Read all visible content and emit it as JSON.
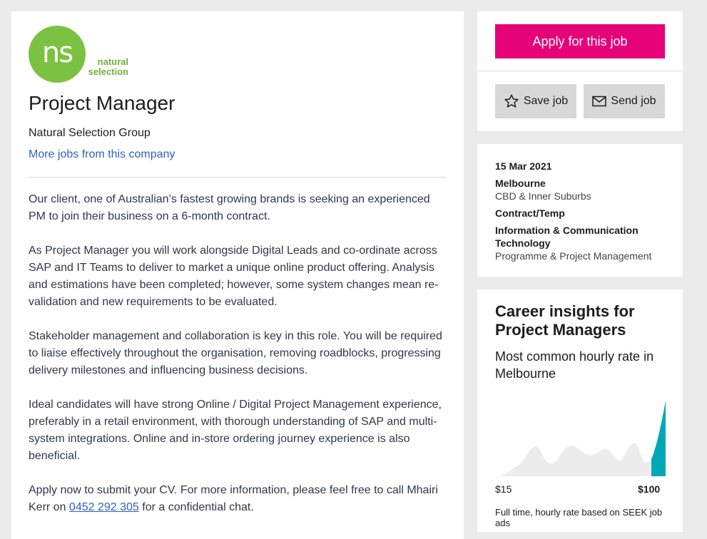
{
  "logo": {
    "initials": "ns",
    "text_line1": "natural",
    "text_line2": "selection"
  },
  "job": {
    "title": "Project Manager",
    "company": "Natural Selection Group",
    "more_jobs_link": "More jobs from this company"
  },
  "description": {
    "p1": "Our client, one of Australian’s fastest growing brands is seeking an experienced PM to join their business on a 6-month contract.",
    "p2": "As Project Manager you will work alongside Digital Leads and co-ordinate across SAP and IT Teams to deliver to market a unique online product offering.  Analysis and estimations have been completed; however, some system changes mean re-validation and new requirements to be evaluated.",
    "p3": "Stakeholder management and collaboration is key in this role.  You will be required to liaise effectively throughout the organisation, removing roadblocks, progressing delivery milestones and influencing business decisions.",
    "p4": "Ideal candidates will have strong Online / Digital Project Management experience, preferably in a retail environment, with thorough understanding of SAP and multi-system integrations.  Online and in-store ordering journey experience is also beneficial.",
    "p5_before": "Apply now to submit your CV.  For more information, please feel free to call Mhairi Kerr on ",
    "phone": "0452 292 305",
    "p5_after": " for a confidential chat."
  },
  "actions": {
    "apply_label": "Apply for this job",
    "save_label": "Save job",
    "send_label": "Send job"
  },
  "meta": {
    "date": "15 Mar 2021",
    "location": "Melbourne",
    "area": "CBD & Inner Suburbs",
    "work_type": "Contract/Temp",
    "classification": "Information & Communication Technology",
    "sub_classification": "Programme & Project Management"
  },
  "insights": {
    "title": "Career insights for Project Managers",
    "subtitle": "Most common hourly rate in Melbourne",
    "min_label": "$15",
    "max_label": "$100",
    "note": "Full time, hourly rate based on SEEK job ads"
  },
  "colors": {
    "apply_button": "#e60278",
    "link": "#2e5fc1",
    "logo_green": "#7cc242",
    "chart_highlight": "#00a8b5",
    "chart_fill": "#ececec"
  },
  "icons": {
    "save": "star-outline-icon",
    "send": "envelope-icon"
  }
}
